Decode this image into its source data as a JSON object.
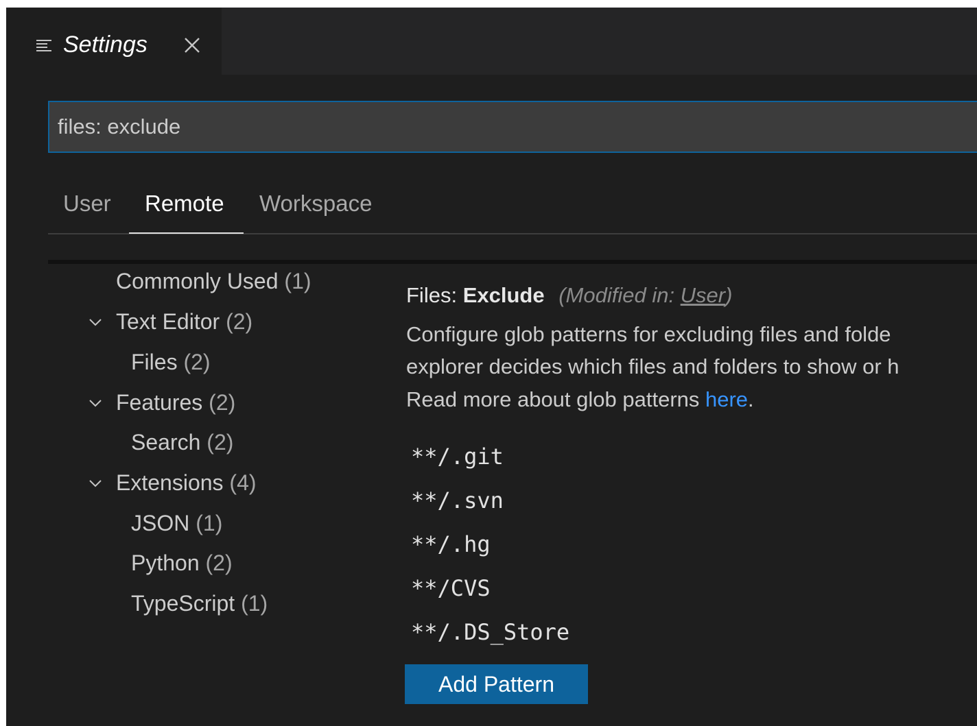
{
  "tab": {
    "title": "Settings",
    "icon": "settings-editor-icon",
    "close_icon": "close-icon"
  },
  "search": {
    "value": "files: exclude"
  },
  "scopes": [
    {
      "label": "User"
    },
    {
      "label": "Remote"
    },
    {
      "label": "Workspace"
    }
  ],
  "active_scope": "Remote",
  "toc": [
    {
      "label": "Commonly Used",
      "count": "(1)"
    },
    {
      "label": "Text Editor",
      "count": "(2)"
    },
    {
      "label": "Files",
      "count": "(2)"
    },
    {
      "label": "Features",
      "count": "(2)"
    },
    {
      "label": "Search",
      "count": "(2)"
    },
    {
      "label": "Extensions",
      "count": "(4)"
    },
    {
      "label": "JSON",
      "count": "(1)"
    },
    {
      "label": "Python",
      "count": "(2)"
    },
    {
      "label": "TypeScript",
      "count": "(1)"
    }
  ],
  "setting": {
    "category": "Files: ",
    "name": "Exclude",
    "modified_prefix": "(Modified in: ",
    "modified_link": "User",
    "modified_suffix": ")",
    "description_lines": [
      "Configure glob patterns for excluding files and folde",
      "explorer decides which files and folders to show or h"
    ],
    "description_last_prefix": "Read more about glob patterns ",
    "description_link": "here",
    "description_last_suffix": ".",
    "patterns": [
      "**/.git",
      "**/.svn",
      "**/.hg",
      "**/CVS",
      "**/.DS_Store"
    ],
    "add_button": "Add Pattern"
  },
  "colors": {
    "background": "#1e1e1e",
    "accent": "#0e639c",
    "link": "#3794ff"
  }
}
